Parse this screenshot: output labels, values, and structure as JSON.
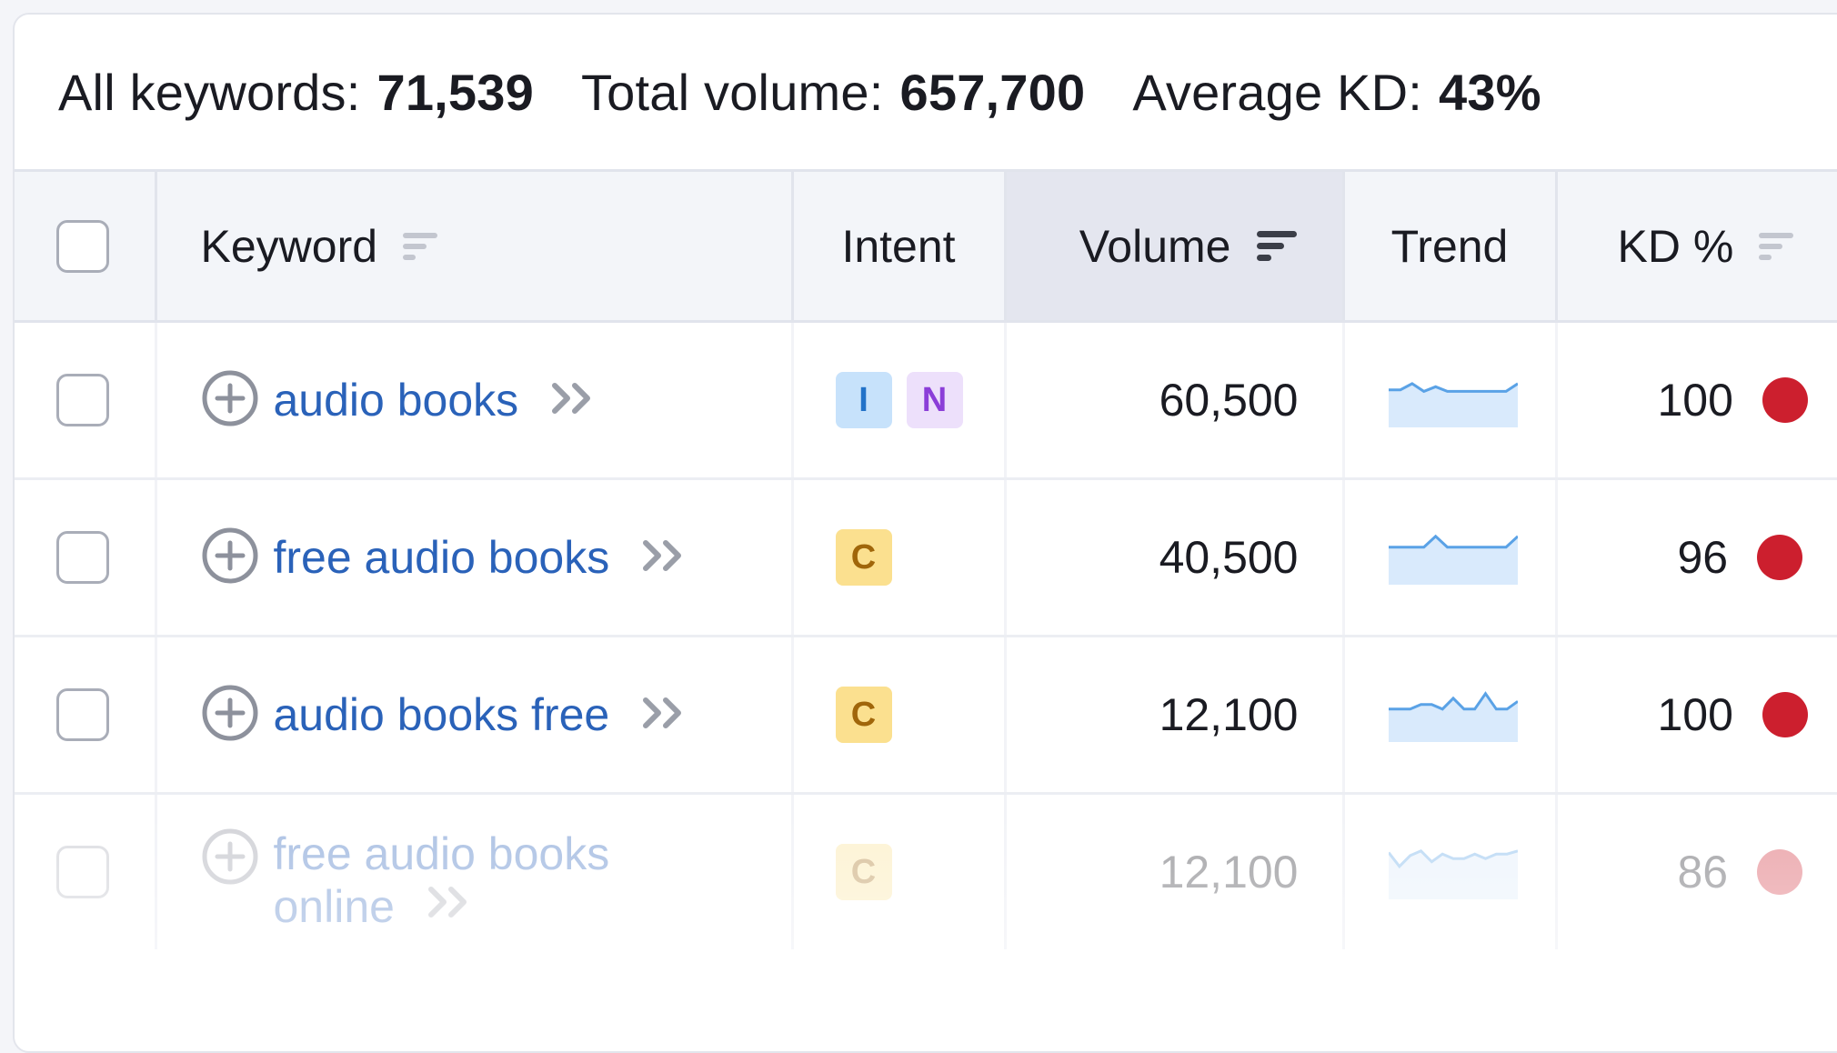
{
  "summary": {
    "all_keywords_label": "All keywords:",
    "all_keywords_value": "71,539",
    "total_volume_label": "Total volume:",
    "total_volume_value": "657,700",
    "average_kd_label": "Average KD:",
    "average_kd_value": "43%"
  },
  "columns": {
    "keyword": "Keyword",
    "intent": "Intent",
    "volume": "Volume",
    "trend": "Trend",
    "kd": "KD %"
  },
  "rows": [
    {
      "keyword": "audio books",
      "intents": [
        "I",
        "N"
      ],
      "volume": "60,500",
      "kd": "100",
      "kd_color": "#cc1f2e",
      "trend": [
        0.55,
        0.55,
        0.35,
        0.6,
        0.45,
        0.6,
        0.6,
        0.6,
        0.6,
        0.6,
        0.6,
        0.35
      ]
    },
    {
      "keyword": "free audio books",
      "intents": [
        "C"
      ],
      "volume": "40,500",
      "kd": "96",
      "kd_color": "#cc1f2e",
      "trend": [
        0.55,
        0.55,
        0.55,
        0.55,
        0.2,
        0.55,
        0.55,
        0.55,
        0.55,
        0.55,
        0.55,
        0.2
      ]
    },
    {
      "keyword": "audio books free",
      "intents": [
        "C"
      ],
      "volume": "12,100",
      "kd": "100",
      "kd_color": "#cc1f2e",
      "trend": [
        0.7,
        0.7,
        0.7,
        0.55,
        0.55,
        0.7,
        0.35,
        0.7,
        0.7,
        0.2,
        0.7,
        0.7,
        0.45
      ]
    },
    {
      "keyword_line1": "free audio books",
      "keyword_line2": "online",
      "intents": [
        "C"
      ],
      "volume": "12,100",
      "kd": "86",
      "kd_color": "#cc1f2e",
      "trend": [
        0.25,
        0.7,
        0.35,
        0.2,
        0.55,
        0.3,
        0.45,
        0.45,
        0.3,
        0.45,
        0.3,
        0.3,
        0.2
      ]
    }
  ],
  "icons": {
    "add": "add-circle-icon",
    "chevrons": "double-chevron-right-icon",
    "sort": "sort-icon"
  }
}
